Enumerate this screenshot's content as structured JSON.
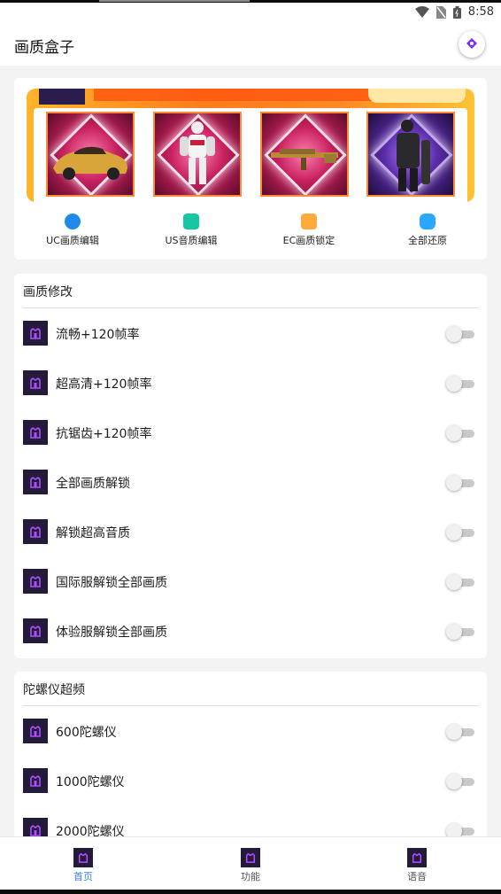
{
  "status_bar": {
    "time": "8:58",
    "icons": [
      "wifi-icon",
      "no-sim-icon",
      "battery-icon"
    ]
  },
  "app_bar": {
    "title": "画质盒子",
    "action_icon": "compass-icon"
  },
  "banner": {
    "prizes": [
      {
        "name": "car",
        "theme": "pink"
      },
      {
        "name": "armor-suit",
        "theme": "pink"
      },
      {
        "name": "rifle",
        "theme": "pink"
      },
      {
        "name": "outfit",
        "theme": "purple"
      }
    ]
  },
  "quick_actions": [
    {
      "label": "UC画质编辑",
      "icon": "globe-icon",
      "color": "#1e8bea"
    },
    {
      "label": "US音质编辑",
      "icon": "headset-icon",
      "color": "#19c6a3"
    },
    {
      "label": "EC画质锁定",
      "icon": "document-icon",
      "color": "#ffab3b"
    },
    {
      "label": "全部还原",
      "icon": "restore-icon",
      "color": "#2aa8ff"
    }
  ],
  "sections": [
    {
      "title": "画质修改",
      "items": [
        {
          "label": "流畅+120帧率",
          "enabled": false
        },
        {
          "label": "超高清+120帧率",
          "enabled": false
        },
        {
          "label": "抗锯齿+120帧率",
          "enabled": false
        },
        {
          "label": "全部画质解锁",
          "enabled": false
        },
        {
          "label": "解锁超高音质",
          "enabled": false
        },
        {
          "label": "国际服解锁全部画质",
          "enabled": false
        },
        {
          "label": "体验服解锁全部画质",
          "enabled": false
        }
      ]
    },
    {
      "title": "陀螺仪超频",
      "items": [
        {
          "label": "600陀螺仪",
          "enabled": false
        },
        {
          "label": "1000陀螺仪",
          "enabled": false
        },
        {
          "label": "2000陀螺仪",
          "enabled": false
        }
      ]
    }
  ],
  "bottom_nav": [
    {
      "label": "首页",
      "active": true
    },
    {
      "label": "功能",
      "active": false
    },
    {
      "label": "语音",
      "active": false
    }
  ],
  "colors": {
    "accent": "#3b7fe0",
    "icon_bg": "#241a3a",
    "icon_fg": "#b14dff",
    "banner_orange": "#ff7a1c"
  }
}
